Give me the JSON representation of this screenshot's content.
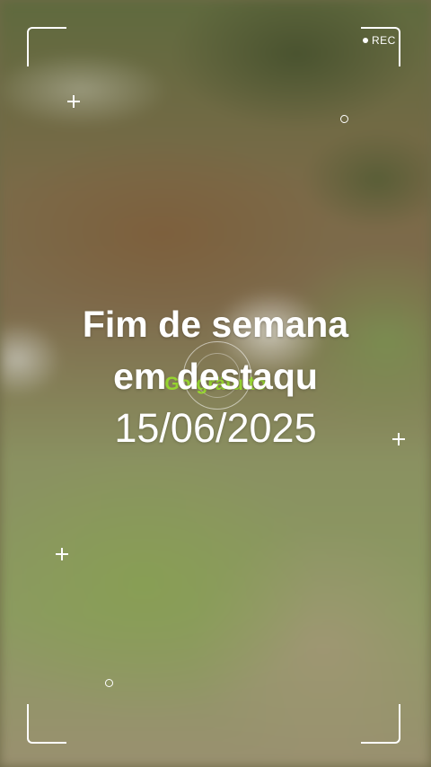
{
  "recording": {
    "label": "REC",
    "indicator_icon": "record-dot-icon"
  },
  "overlay": {
    "title_line1": "Fim de semana",
    "title_line2": "em destaqu",
    "subtitle": "Go grätuito",
    "date": "15/06/2025"
  },
  "colors": {
    "frame": "#ffffff",
    "accent_green": "#9be52a"
  },
  "icons": [
    "corner-bracket-icon",
    "plus-icon",
    "circle-marker-icon",
    "focus-ring-icon"
  ]
}
